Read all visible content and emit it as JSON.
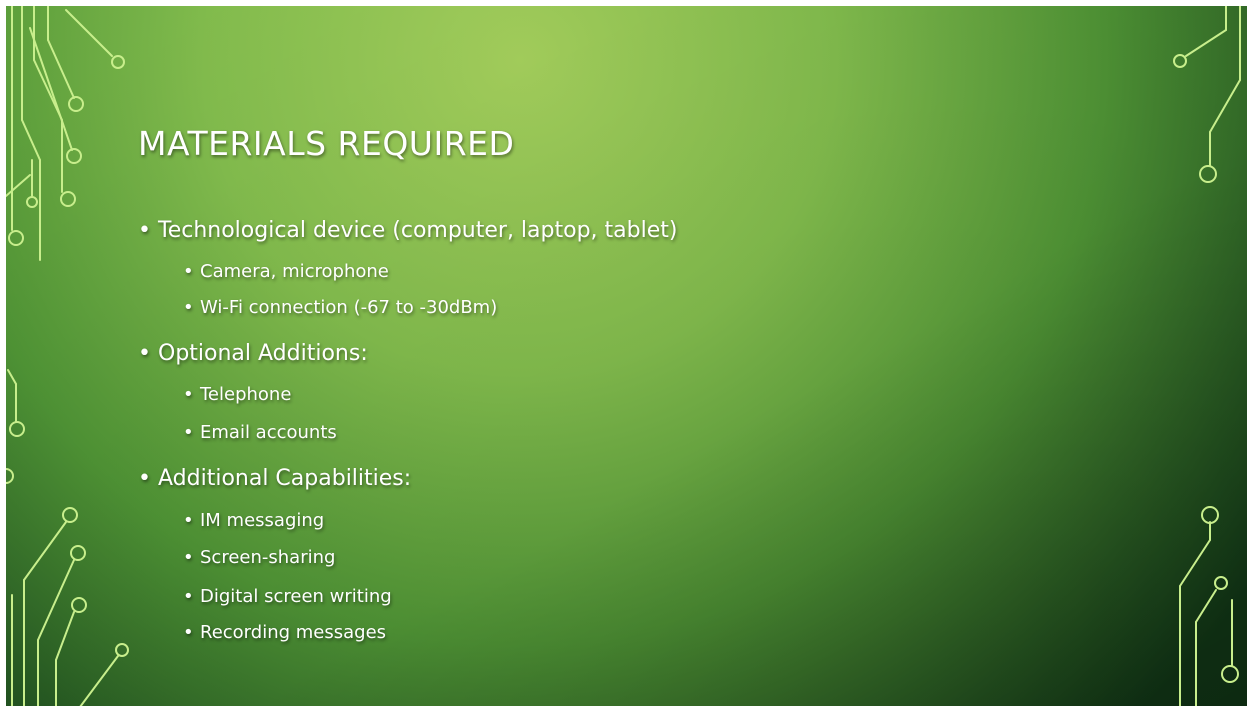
{
  "slide": {
    "title": "MATERIALS REQUIRED",
    "bullets": [
      {
        "text": "Technological device (computer, laptop, tablet)",
        "sub": [
          "Camera, microphone",
          "Wi-Fi connection (-67 to -30dBm)"
        ]
      },
      {
        "text": "Optional Additions:",
        "sub": [
          "Telephone",
          "Email accounts"
        ]
      },
      {
        "text": "Additional Capabilities:",
        "sub": [
          "IM messaging",
          "Screen-sharing",
          "Digital screen writing",
          "Recording messages"
        ]
      }
    ]
  },
  "bullet_glyph": "•",
  "colors": {
    "background_light": "#a4cf5c",
    "background_mid": "#5ea23b",
    "background_dark": "#14401a",
    "text": "#ffffff",
    "circuit_line": "#c8ee8c"
  }
}
